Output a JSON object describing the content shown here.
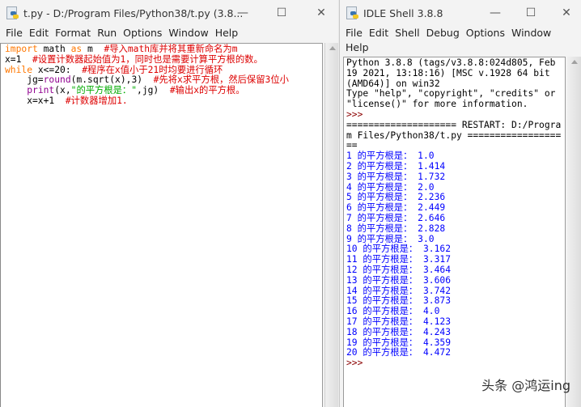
{
  "editor": {
    "title": "t.py - D:/Program Files/Python38/t.py (3.8...",
    "menu": [
      "File",
      "Edit",
      "Format",
      "Run",
      "Options",
      "Window",
      "Help"
    ],
    "code_lines": [
      [
        {
          "t": "import",
          "c": "kw"
        },
        {
          "t": " math ",
          "c": "def"
        },
        {
          "t": "as",
          "c": "kw"
        },
        {
          "t": " m  ",
          "c": "def"
        },
        {
          "t": "#导入math库并将其重新命名为m",
          "c": "cm"
        }
      ],
      [
        {
          "t": "x=1  ",
          "c": "def"
        },
        {
          "t": "#设置计数器起始值为1，同时也是需要计算平方根的数。",
          "c": "cm"
        }
      ],
      [
        {
          "t": "while",
          "c": "kw"
        },
        {
          "t": " x<=20:  ",
          "c": "def"
        },
        {
          "t": "#程序在x值小于21时均要进行循环",
          "c": "cm"
        }
      ],
      [
        {
          "t": "    jg=",
          "c": "def"
        },
        {
          "t": "round",
          "c": "bi"
        },
        {
          "t": "(m.sqrt(x),3)  ",
          "c": "def"
        },
        {
          "t": "#先将x求平方根，然后保留3位小",
          "c": "cm"
        }
      ],
      [
        {
          "t": "    ",
          "c": "def"
        },
        {
          "t": "print",
          "c": "bi"
        },
        {
          "t": "(x,",
          "c": "def"
        },
        {
          "t": "\"的平方根是：\"",
          "c": "str"
        },
        {
          "t": ",jg)  ",
          "c": "def"
        },
        {
          "t": "#输出x的平方根。",
          "c": "cm"
        }
      ],
      [
        {
          "t": "    x=x+1  ",
          "c": "def"
        },
        {
          "t": "#计数器增加1.",
          "c": "cm"
        }
      ]
    ]
  },
  "shell": {
    "title": "IDLE Shell 3.8.8",
    "menu": [
      "File",
      "Edit",
      "Shell",
      "Debug",
      "Options",
      "Window",
      "Help"
    ],
    "banner": "Python 3.8.8 (tags/v3.8.8:024d805, Feb 19 2021, 13:18:16) [MSC v.1928 64 bit (AMD64)] on win32\nType \"help\", \"copyright\", \"credits\" or \"license()\" for more information.",
    "prompt": ">>>",
    "restart_line": "==================== RESTART: D:/Program Files/Python38/t.py ===================",
    "output_label": "的平方根是：",
    "results": [
      {
        "n": "1",
        "v": "1.0"
      },
      {
        "n": "2",
        "v": "1.414"
      },
      {
        "n": "3",
        "v": "1.732"
      },
      {
        "n": "4",
        "v": "2.0"
      },
      {
        "n": "5",
        "v": "2.236"
      },
      {
        "n": "6",
        "v": "2.449"
      },
      {
        "n": "7",
        "v": "2.646"
      },
      {
        "n": "8",
        "v": "2.828"
      },
      {
        "n": "9",
        "v": "3.0"
      },
      {
        "n": "10",
        "v": "3.162"
      },
      {
        "n": "11",
        "v": "3.317"
      },
      {
        "n": "12",
        "v": "3.464"
      },
      {
        "n": "13",
        "v": "3.606"
      },
      {
        "n": "14",
        "v": "3.742"
      },
      {
        "n": "15",
        "v": "3.873"
      },
      {
        "n": "16",
        "v": "4.0"
      },
      {
        "n": "17",
        "v": "4.123"
      },
      {
        "n": "18",
        "v": "4.243"
      },
      {
        "n": "19",
        "v": "4.359"
      },
      {
        "n": "20",
        "v": "4.472"
      }
    ],
    "final_prompt": ">>>"
  },
  "window_controls": {
    "minimize": "—",
    "maximize": "☐",
    "close": "✕"
  },
  "watermark": "头条 @鸿运ing"
}
